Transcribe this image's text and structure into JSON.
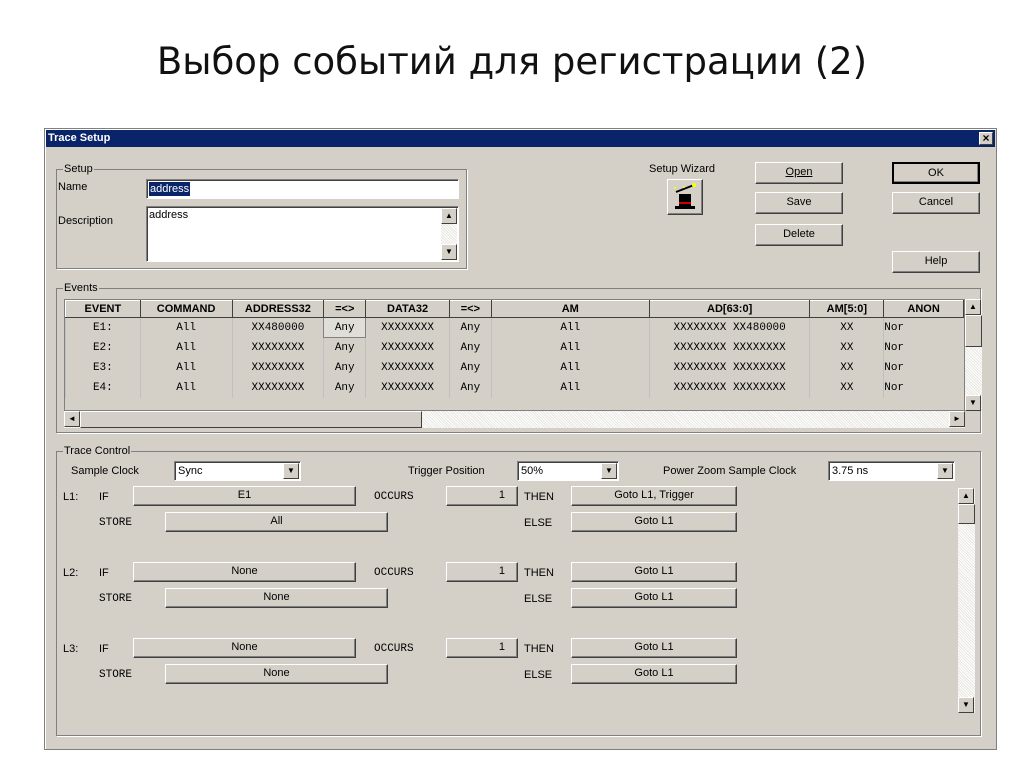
{
  "slide": {
    "title": "Выбор событий для регистрации (2)"
  },
  "window": {
    "title": "Trace Setup",
    "close": "×"
  },
  "setup": {
    "group_label": "Setup",
    "name_label": "Name",
    "name_value": "address",
    "description_label": "Description",
    "description_value": "address",
    "wizard_label": "Setup Wizard"
  },
  "buttons": {
    "open": "Open",
    "save": "Save",
    "delete": "Delete",
    "ok": "OK",
    "cancel": "Cancel",
    "help": "Help"
  },
  "events": {
    "group_label": "Events",
    "columns": [
      "EVENT",
      "COMMAND",
      "ADDRESS32",
      "=<>",
      "DATA32",
      "=<>",
      "AM",
      "AD[63:0]",
      "AM[5:0]",
      "ANON"
    ],
    "rows": [
      [
        "E1:",
        "All",
        "XX480000",
        "Any",
        "XXXXXXXX",
        "Any",
        "All",
        "XXXXXXXX XX480000",
        "XX",
        "Nor"
      ],
      [
        "E2:",
        "All",
        "XXXXXXXX",
        "Any",
        "XXXXXXXX",
        "Any",
        "All",
        "XXXXXXXX XXXXXXXX",
        "XX",
        "Nor"
      ],
      [
        "E3:",
        "All",
        "XXXXXXXX",
        "Any",
        "XXXXXXXX",
        "Any",
        "All",
        "XXXXXXXX XXXXXXXX",
        "XX",
        "Nor"
      ],
      [
        "E4:",
        "All",
        "XXXXXXXX",
        "Any",
        "XXXXXXXX",
        "Any",
        "All",
        "XXXXXXXX XXXXXXXX",
        "XX",
        "Nor"
      ]
    ]
  },
  "trace": {
    "group_label": "Trace Control",
    "sample_clock_label": "Sample Clock",
    "sample_clock_value": "Sync",
    "trigger_position_label": "Trigger Position",
    "trigger_position_value": "50%",
    "power_zoom_label": "Power Zoom Sample Clock",
    "power_zoom_value": "3.75 ns",
    "levels": [
      {
        "label": "L1:",
        "if": "IF",
        "if_value": "E1",
        "occurs": "OCCURS",
        "count": "1",
        "then": "THEN",
        "then_value": "Goto L1, Trigger",
        "store": "STORE",
        "store_value": "All",
        "else": "ELSE",
        "else_value": "Goto L1"
      },
      {
        "label": "L2:",
        "if": "IF",
        "if_value": "None",
        "occurs": "OCCURS",
        "count": "1",
        "then": "THEN",
        "then_value": "Goto L1",
        "store": "STORE",
        "store_value": "None",
        "else": "ELSE",
        "else_value": "Goto L1"
      },
      {
        "label": "L3:",
        "if": "IF",
        "if_value": "None",
        "occurs": "OCCURS",
        "count": "1",
        "then": "THEN",
        "then_value": "Goto L1",
        "store": "STORE",
        "store_value": "None",
        "else": "ELSE",
        "else_value": "Goto L1"
      }
    ]
  },
  "icons": {
    "wizard": "magic-hat-icon",
    "up": "▲",
    "down": "▼",
    "left": "◄",
    "right": "►"
  },
  "colors": {
    "titlebar": "#0a246a",
    "face": "#d4d0c8",
    "selection": "#0a246a"
  }
}
